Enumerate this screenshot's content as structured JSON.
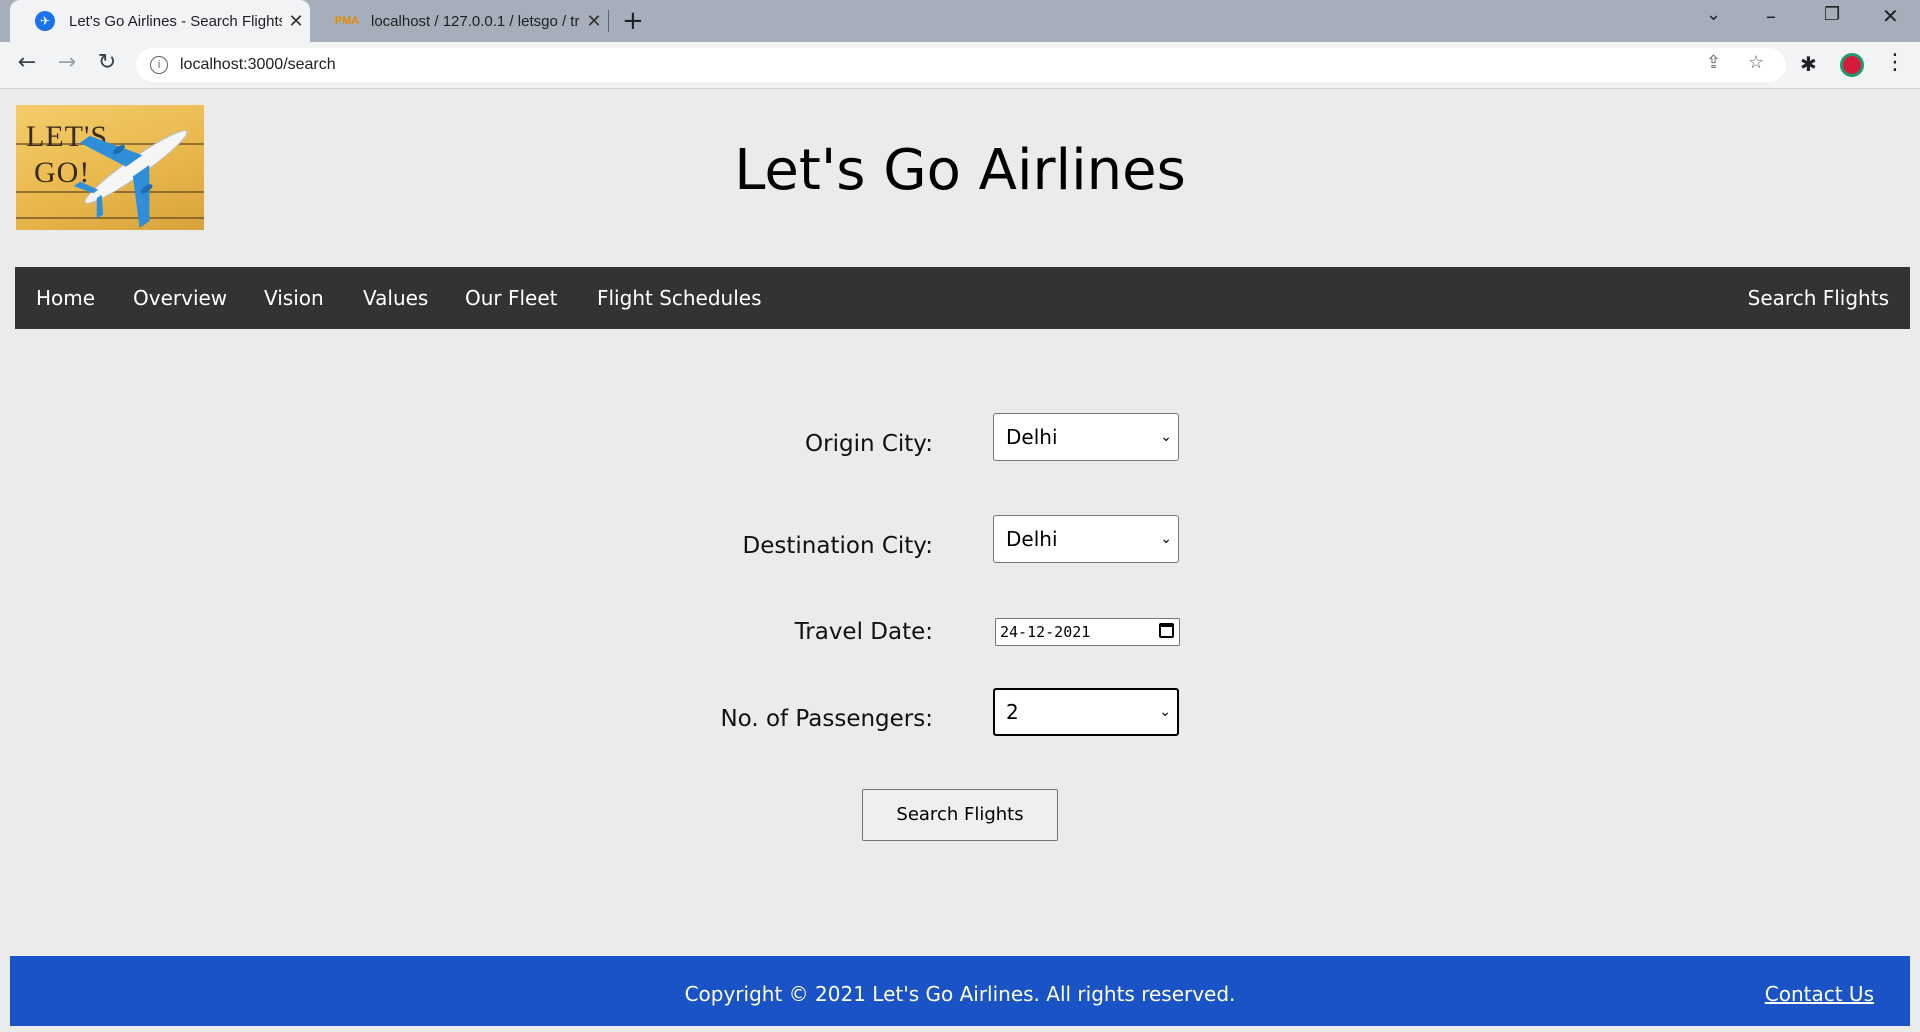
{
  "browser": {
    "tabs": [
      {
        "title": "Let's Go Airlines - Search Flights",
        "active": true
      },
      {
        "title": "localhost / 127.0.0.1 / letsgo / trip",
        "active": false
      }
    ],
    "favicon_pma": "PMA",
    "url": "localhost:3000/search",
    "icons": {
      "back": "arrow-left-icon",
      "forward": "arrow-right-icon",
      "reload": "reload-icon",
      "info": "info-icon",
      "share": "share-icon",
      "star": "star-icon",
      "extensions": "puzzle-icon",
      "profile": "profile-avatar",
      "menu": "kebab-menu-icon"
    }
  },
  "site": {
    "logo_text_line1": "LET'S",
    "logo_text_line2": "GO!",
    "title": "Let's Go Airlines"
  },
  "nav": {
    "items": [
      "Home",
      "Overview",
      "Vision",
      "Values",
      "Our Fleet",
      "Flight Schedules"
    ],
    "right_item": "Search Flights"
  },
  "form": {
    "origin_label": "Origin City:",
    "origin_value": "Delhi",
    "destination_label": "Destination City:",
    "destination_value": "Delhi",
    "date_label": "Travel Date:",
    "date_value": "24-12-2021",
    "passengers_label": "No. of Passengers:",
    "passengers_value": "2",
    "submit_label": "Search Flights"
  },
  "footer": {
    "copyright": "Copyright © 2021 Let's Go Airlines. All rights reserved.",
    "contact": "Contact Us"
  },
  "colors": {
    "nav_bg": "#333333",
    "footer_bg": "#1a53c6",
    "page_bg": "#ebebeb"
  }
}
